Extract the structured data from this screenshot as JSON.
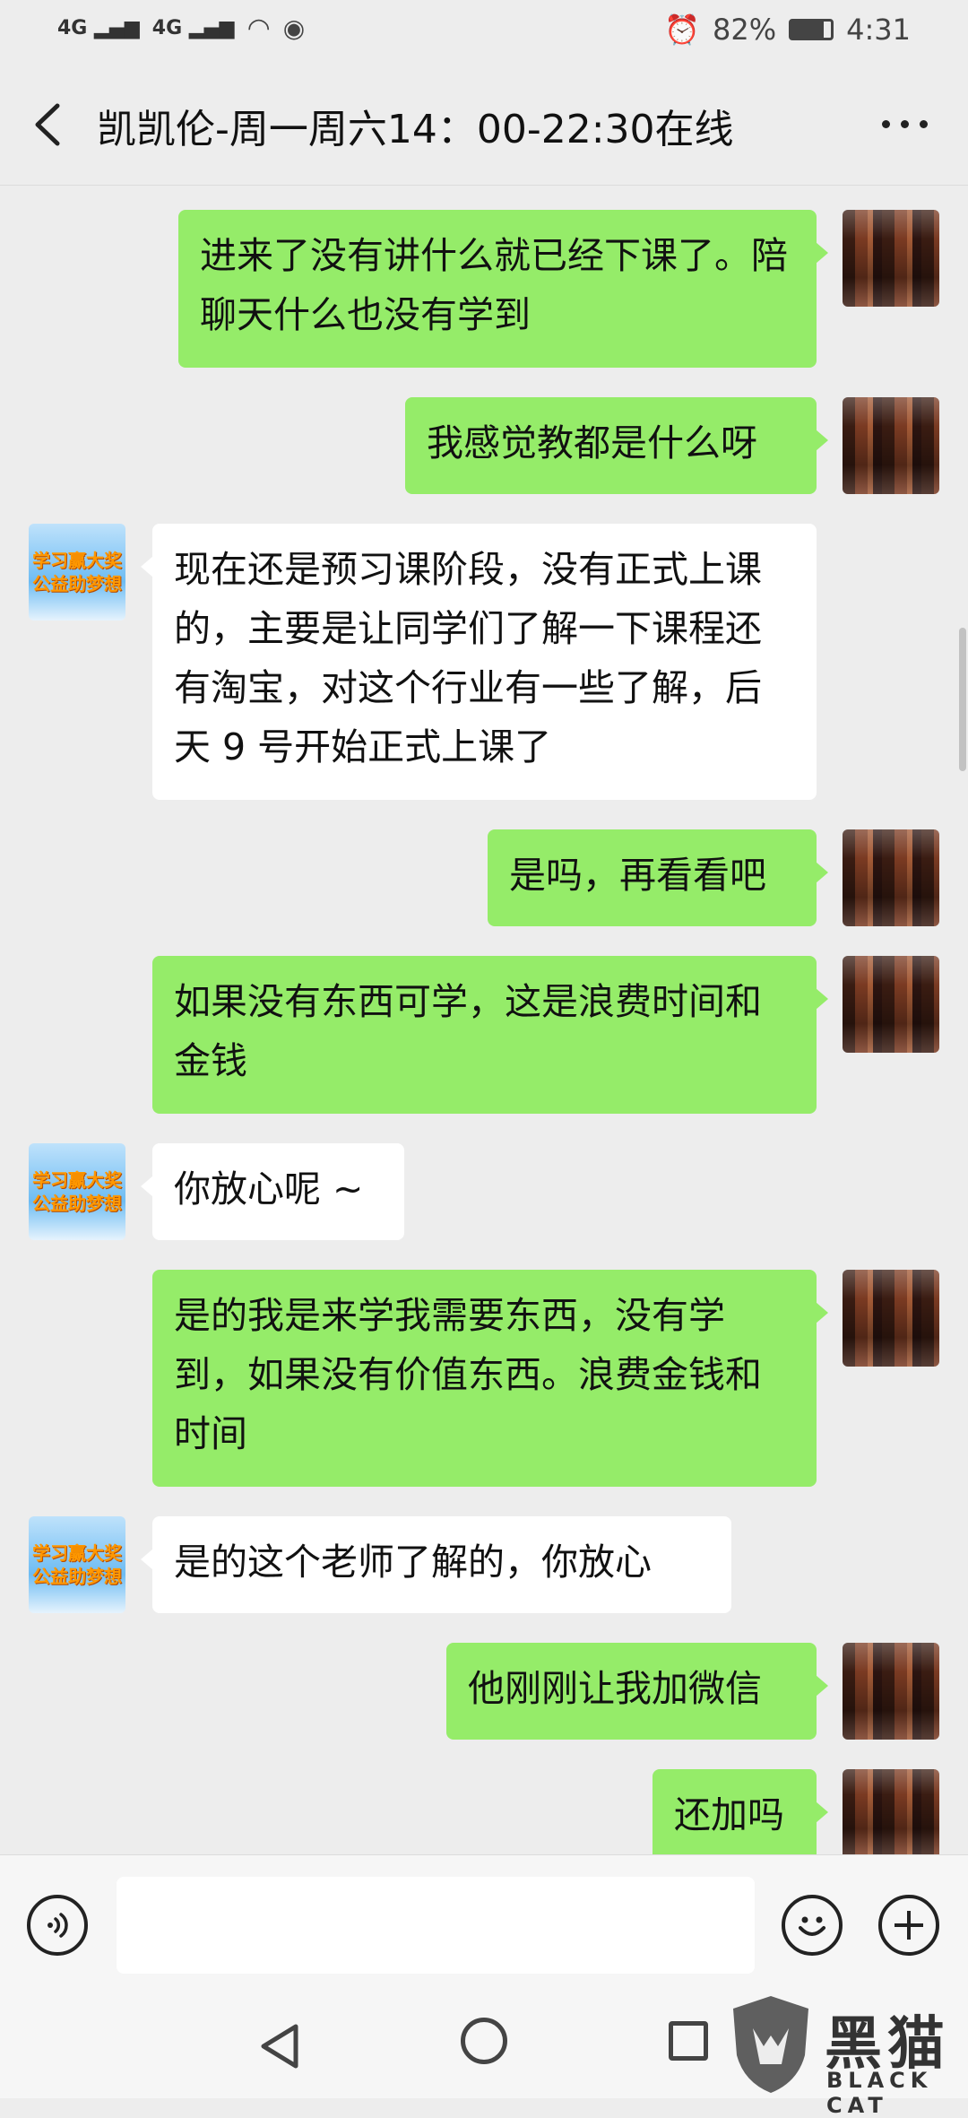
{
  "status_bar": {
    "signal1": "4G",
    "signal2": "4G",
    "battery": "82%",
    "time": "4:31"
  },
  "header": {
    "title": "凯凯伦-周一周六14：00-22:30在线"
  },
  "messages": [
    {
      "side": "me",
      "text": "进来了没有讲什么就已经下课了。陪聊天什么也没有学到"
    },
    {
      "side": "me",
      "text": "我感觉教都是什么呀"
    },
    {
      "side": "other",
      "text": "现在还是预习课阶段，没有正式上课的，主要是让同学们了解一下课程还有淘宝，对这个行业有一些了解，后天 9 号开始正式上课了"
    },
    {
      "side": "me",
      "text": "是吗，再看看吧"
    },
    {
      "side": "me",
      "text": "如果没有东西可学，这是浪费时间和金钱"
    },
    {
      "side": "other",
      "text": "你放心呢 ~"
    },
    {
      "side": "me",
      "text": "是的我是来学我需要东西，没有学到，如果没有价值东西。浪费金钱和时间"
    },
    {
      "side": "other",
      "text": "是的这个老师了解的，你放心"
    },
    {
      "side": "me",
      "text": "他刚刚让我加微信"
    },
    {
      "side": "me",
      "text": "还加吗"
    }
  ],
  "other_avatar": {
    "line1": "学习赢大奖",
    "line2": "公益助梦想"
  },
  "icons": {
    "voice": "voice-icon",
    "emoji": "emoji-icon",
    "plus": "plus-icon",
    "back": "back-arrow-icon",
    "more": "more-icon"
  },
  "watermark": {
    "main": "黑猫",
    "sub": "BLACK CAT"
  },
  "colors": {
    "my_bubble": "#95ec69",
    "other_bubble": "#ffffff",
    "background": "#ededed"
  }
}
